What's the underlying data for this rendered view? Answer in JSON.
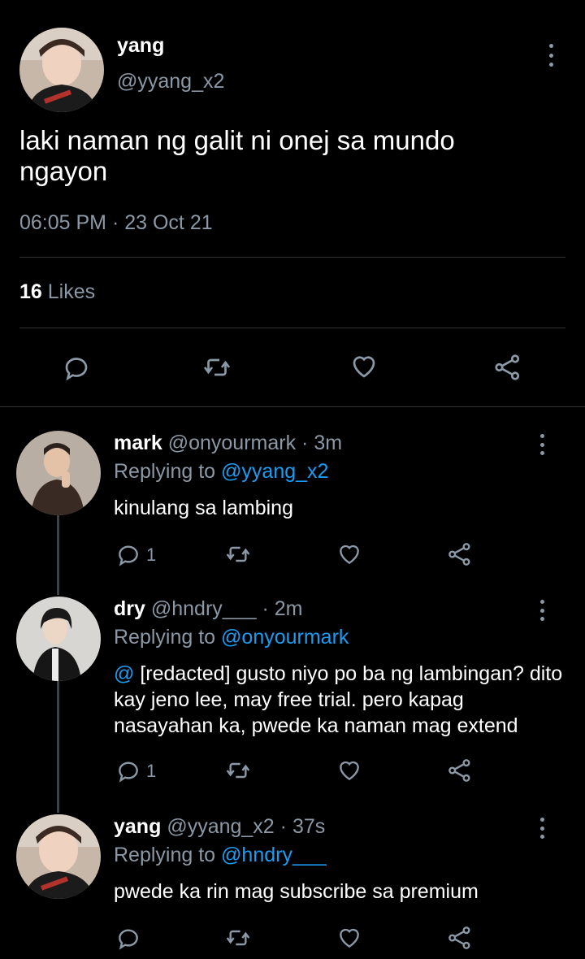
{
  "main_tweet": {
    "name": "yang",
    "handle": "@yyang_x2",
    "text": "laki naman ng galit ni onej sa mundo ngayon",
    "timestamp": "06:05 PM · 23 Oct 21",
    "likes_count": "16",
    "likes_label": "Likes"
  },
  "replies": [
    {
      "name": "mark",
      "handle": "@onyourmark",
      "time": "· 3m",
      "replying_prefix": "Replying to",
      "replying_to": "@yyang_x2",
      "text": "kinulang sa lambing",
      "reply_count": "1"
    },
    {
      "name": "dry",
      "handle": "@hndry___",
      "time": "· 2m",
      "replying_prefix": "Replying to",
      "replying_to": "@onyourmark",
      "mention": "@",
      "text": "[redacted] gusto niyo po ba ng lambingan? dito kay jeno lee, may free trial. pero kapag nasayahan ka, pwede ka naman mag extend",
      "reply_count": "1"
    },
    {
      "name": "yang",
      "handle": "@yyang_x2",
      "time": "· 37s",
      "replying_prefix": "Replying to",
      "replying_to": "@hndry___",
      "text": "pwede ka rin mag subscribe sa premium",
      "reply_count": ""
    }
  ],
  "icons": {
    "reply": "speech-bubble",
    "retweet": "retweet-arrows",
    "like": "heart",
    "share": "share-nodes",
    "more": "vertical-dots"
  },
  "colors": {
    "background": "#000000",
    "link": "#1d9bf0",
    "muted": "#8b98a5",
    "divider": "#2f3336"
  }
}
